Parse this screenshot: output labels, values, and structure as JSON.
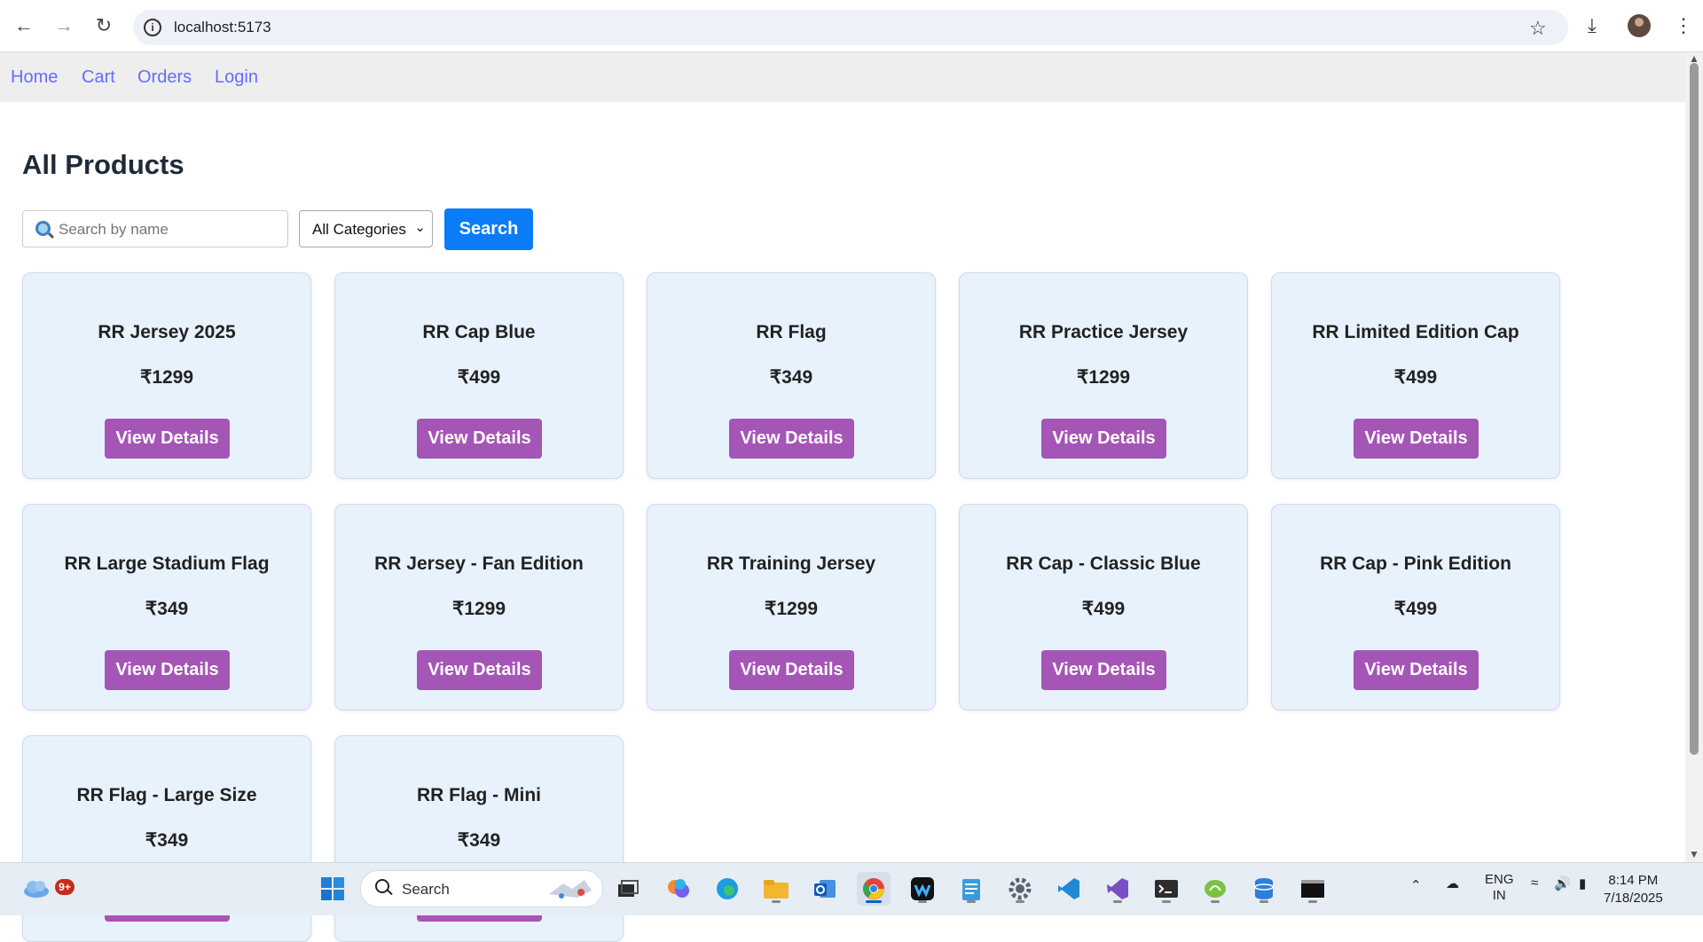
{
  "browser": {
    "url": "localhost:5173"
  },
  "nav": {
    "links": [
      "Home",
      "Cart",
      "Orders",
      "Login"
    ]
  },
  "page": {
    "title": "All Products",
    "search_placeholder": "Search by name",
    "category_selected": "All Categories",
    "search_button": "Search"
  },
  "products": [
    {
      "name": "RR Jersey 2025",
      "price": "₹1299",
      "button": "View Details"
    },
    {
      "name": "RR Cap Blue",
      "price": "₹499",
      "button": "View Details"
    },
    {
      "name": "RR Flag",
      "price": "₹349",
      "button": "View Details"
    },
    {
      "name": "RR Practice Jersey",
      "price": "₹1299",
      "button": "View Details"
    },
    {
      "name": "RR Limited Edition Cap",
      "price": "₹499",
      "button": "View Details"
    },
    {
      "name": "RR Large Stadium Flag",
      "price": "₹349",
      "button": "View Details"
    },
    {
      "name": "RR Jersey - Fan Edition",
      "price": "₹1299",
      "button": "View Details"
    },
    {
      "name": "RR Training Jersey",
      "price": "₹1299",
      "button": "View Details"
    },
    {
      "name": "RR Cap - Classic Blue",
      "price": "₹499",
      "button": "View Details"
    },
    {
      "name": "RR Cap - Pink Edition",
      "price": "₹499",
      "button": "View Details"
    },
    {
      "name": "RR Flag - Large Size",
      "price": "₹349",
      "button": "View Details"
    },
    {
      "name": "RR Flag - Mini",
      "price": "₹349",
      "button": "View Details"
    }
  ],
  "taskbar": {
    "search_label": "Search",
    "weather_badge": "9+",
    "lang_top": "ENG",
    "lang_bottom": "IN",
    "time": "8:14 PM",
    "date": "7/18/2025"
  },
  "colors": {
    "link": "#646cff",
    "primary_button": "#0b7cf7",
    "details_button": "#a555b5",
    "card_bg": "#e8f2fd"
  }
}
